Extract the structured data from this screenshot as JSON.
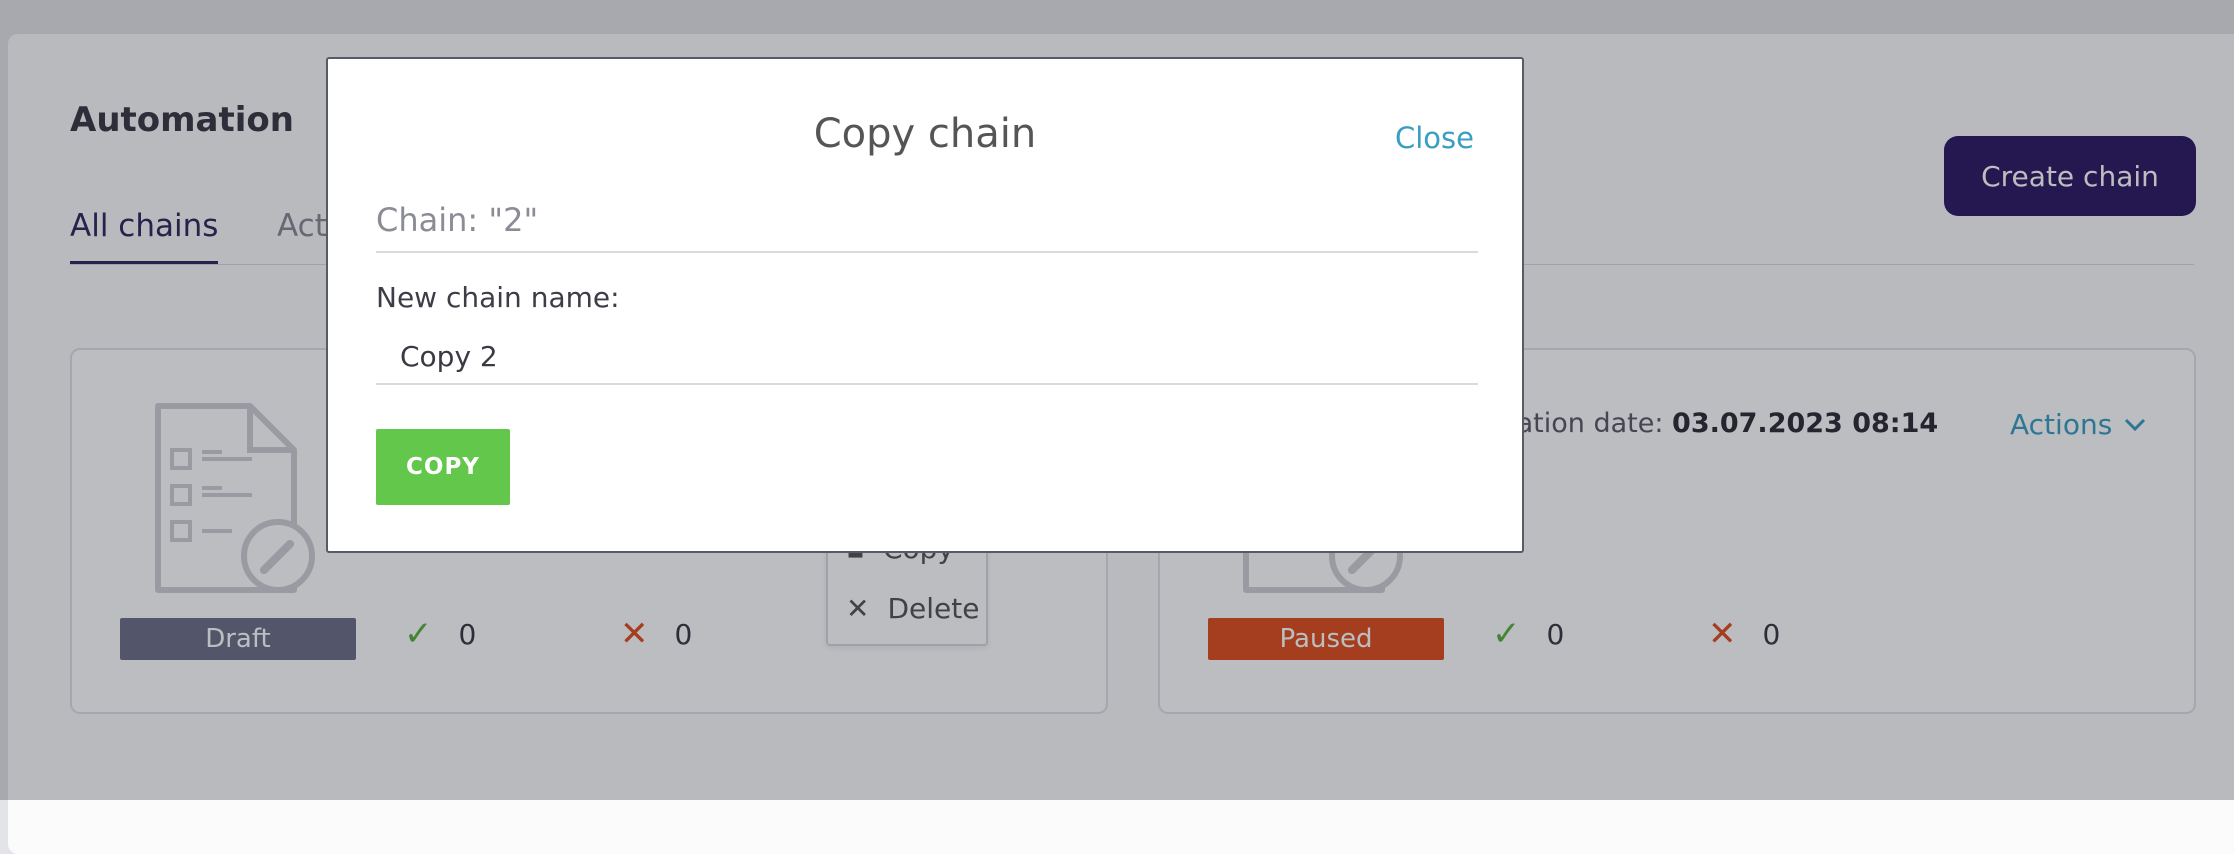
{
  "page": {
    "title": "Automation"
  },
  "tabs": [
    {
      "label": "All chains"
    },
    {
      "label": "Act"
    }
  ],
  "header": {
    "create_label": "Create chain"
  },
  "cards": [
    {
      "status": "Draft",
      "success_count": "0",
      "fail_count": "0",
      "menu": {
        "copy_label": "Copy",
        "delete_label": "Delete"
      }
    },
    {
      "created_prefix": "eation date:",
      "created_value": "03.07.2023 08:14",
      "actions_label": "Actions",
      "status": "Paused",
      "success_count": "0",
      "fail_count": "0"
    }
  ],
  "modal": {
    "title": "Copy chain",
    "close_label": "Close",
    "chain_text": "Chain: \"2\"",
    "name_label": "New chain name:",
    "name_value": "Copy 2",
    "copy_button": "COPY"
  },
  "colors": {
    "accent": "#2e1a63",
    "link": "#3a9ec2",
    "success": "#58b042",
    "danger": "#e04f1f",
    "copy_button": "#62c74a"
  }
}
